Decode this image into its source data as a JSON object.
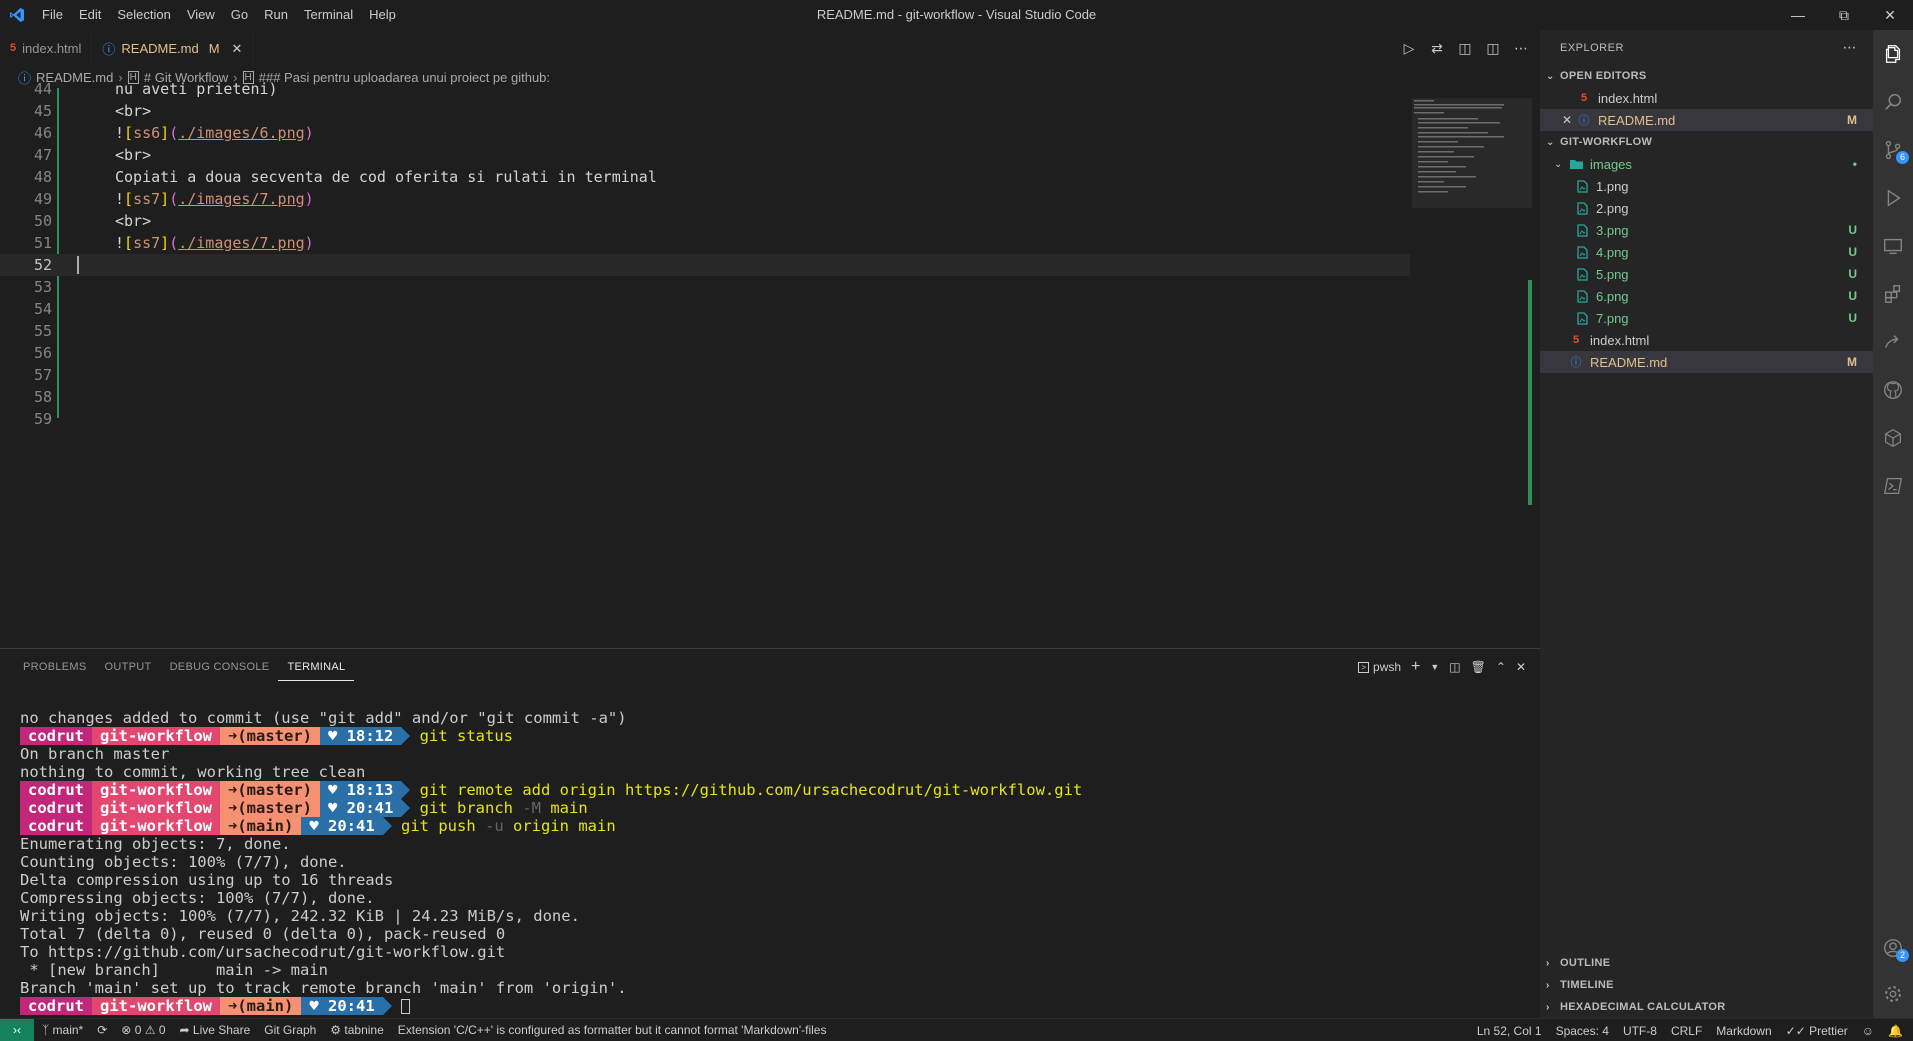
{
  "window": {
    "title": "README.md - git-workflow - Visual Studio Code",
    "menu": [
      "File",
      "Edit",
      "Selection",
      "View",
      "Go",
      "Run",
      "Terminal",
      "Help"
    ]
  },
  "tabs": [
    {
      "label": "index.html",
      "status": "",
      "icon": "html-file-icon"
    },
    {
      "label": "README.md",
      "status": "M",
      "icon": "info-icon"
    }
  ],
  "breadcrumbs": [
    "README.md",
    "# Git Workflow",
    "### Pasi pentru uploadarea unui proiect pe github:"
  ],
  "editor": {
    "partial_top": "nu aveti prieteni)",
    "lines": [
      {
        "n": "44",
        "text": ""
      },
      {
        "n": "45",
        "text": "<br>"
      },
      {
        "n": "46",
        "alt": "ss6",
        "link": "./images/6.png"
      },
      {
        "n": "47",
        "text": "<br>"
      },
      {
        "n": "48",
        "text": "Copiati a doua secventa de cod oferita si rulati in terminal"
      },
      {
        "n": "49",
        "alt": "ss7",
        "link": "./images/7.png"
      },
      {
        "n": "50",
        "text": "<br>"
      },
      {
        "n": "51",
        "alt": "ss7",
        "link": "./images/7.png"
      },
      {
        "n": "52",
        "text": ""
      },
      {
        "n": "53",
        "text": ""
      },
      {
        "n": "54",
        "text": ""
      },
      {
        "n": "55",
        "text": ""
      },
      {
        "n": "56",
        "text": ""
      },
      {
        "n": "57",
        "text": ""
      },
      {
        "n": "58",
        "text": ""
      },
      {
        "n": "59",
        "text": ""
      }
    ]
  },
  "panel": {
    "tabs": [
      "PROBLEMS",
      "OUTPUT",
      "DEBUG CONSOLE",
      "TERMINAL"
    ],
    "active_tab": "TERMINAL",
    "shell": "pwsh"
  },
  "prompt": {
    "user": "codrut",
    "dir": "git-workflow"
  },
  "terminal": [
    {
      "type": "out",
      "text": "no changes added to commit (use \"git add\" and/or \"git commit -a\")"
    },
    {
      "type": "prompt",
      "branch": "(master)",
      "time": "18:12",
      "cmd": "git status",
      "flag": "",
      "rest": ""
    },
    {
      "type": "out",
      "text": "On branch master"
    },
    {
      "type": "out",
      "text": "nothing to commit, working tree clean"
    },
    {
      "type": "prompt",
      "branch": "(master)",
      "time": "18:13",
      "cmd": "git remote add origin https://github.com/ursachecodrut/git-workflow.git",
      "flag": "",
      "rest": ""
    },
    {
      "type": "prompt",
      "branch": "(master)",
      "time": "20:41",
      "cmd": "git branch ",
      "flag": "-M",
      "rest": " main"
    },
    {
      "type": "prompt",
      "branch": "(main)",
      "time": "20:41",
      "cmd": "git push ",
      "flag": "-u",
      "rest": " origin main"
    },
    {
      "type": "out",
      "text": "Enumerating objects: 7, done."
    },
    {
      "type": "out",
      "text": "Counting objects: 100% (7/7), done."
    },
    {
      "type": "out",
      "text": "Delta compression using up to 16 threads"
    },
    {
      "type": "out",
      "text": "Compressing objects: 100% (7/7), done."
    },
    {
      "type": "out",
      "text": "Writing objects: 100% (7/7), 242.32 KiB | 24.23 MiB/s, done."
    },
    {
      "type": "out",
      "text": "Total 7 (delta 0), reused 0 (delta 0), pack-reused 0"
    },
    {
      "type": "out",
      "text": "To https://github.com/ursachecodrut/git-workflow.git"
    },
    {
      "type": "out",
      "text": " * [new branch]      main -> main"
    },
    {
      "type": "out",
      "text": "Branch 'main' set up to track remote branch 'main' from 'origin'."
    },
    {
      "type": "prompt",
      "branch": "(main)",
      "time": "20:41",
      "cmd": "",
      "flag": "",
      "rest": "",
      "cursor": true
    }
  ],
  "explorer": {
    "header": "EXPLORER",
    "open_editors_label": "OPEN EDITORS",
    "open_editors": [
      {
        "label": "index.html",
        "icon": "html",
        "badge": ""
      },
      {
        "label": "README.md",
        "icon": "info",
        "badge": "M"
      }
    ],
    "folder_label": "GIT-WORKFLOW",
    "tree": [
      {
        "label": "images",
        "icon": "folder",
        "badge": "•",
        "depth": 1
      },
      {
        "label": "1.png",
        "icon": "png",
        "badge": "",
        "depth": 2
      },
      {
        "label": "2.png",
        "icon": "png",
        "badge": "",
        "depth": 2
      },
      {
        "label": "3.png",
        "icon": "png",
        "badge": "U",
        "depth": 2
      },
      {
        "label": "4.png",
        "icon": "png",
        "badge": "U",
        "depth": 2
      },
      {
        "label": "5.png",
        "icon": "png",
        "badge": "U",
        "depth": 2
      },
      {
        "label": "6.png",
        "icon": "png",
        "badge": "U",
        "depth": 2
      },
      {
        "label": "7.png",
        "icon": "png",
        "badge": "U",
        "depth": 2
      },
      {
        "label": "index.html",
        "icon": "html",
        "badge": "",
        "depth": 1
      },
      {
        "label": "README.md",
        "icon": "info",
        "badge": "M",
        "depth": 1
      }
    ],
    "bottom_sections": [
      "OUTLINE",
      "TIMELINE",
      "HEXADECIMAL CALCULATOR"
    ]
  },
  "activity_badges": {
    "source_control": "6",
    "accounts": "2"
  },
  "statusbar": {
    "branch": "main*",
    "errors": "0",
    "warnings": "0",
    "live_share": "Live Share",
    "git_graph": "Git Graph",
    "tabnine": "tabnine",
    "message": "Extension 'C/C++' is configured as formatter but it cannot format 'Markdown'-files",
    "position": "Ln 52, Col 1",
    "spaces": "Spaces: 4",
    "encoding": "UTF-8",
    "eol": "CRLF",
    "language": "Markdown",
    "prettier": "Prettier"
  },
  "colors": {
    "accent": "#007acc",
    "modified": "#e2c08d",
    "untracked": "#73c991",
    "prompt_user": "#c3277a",
    "prompt_dir": "#e3476f",
    "prompt_branch": "#f59072",
    "prompt_time": "#2a6fa7",
    "command": "#e5e510"
  }
}
